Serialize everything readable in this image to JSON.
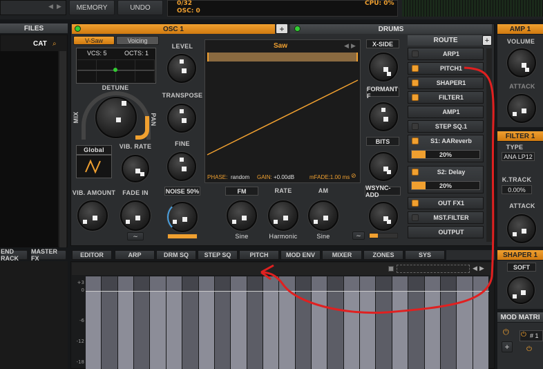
{
  "top": {
    "memory": "MEMORY",
    "undo": "UNDO",
    "voices": "0/32",
    "osc": "OSC: 0",
    "cpu": "CPU: 0%"
  },
  "files": {
    "title": "FILES",
    "cat": "CAT"
  },
  "osc": {
    "title": "OSC 1",
    "add": "+",
    "drums": "DRUMS",
    "vsaw_tab": "V-Saw",
    "voicing_tab": "Voicing",
    "vcs": "VCS: 5",
    "octs": "OCTS: 1",
    "detune": "DETUNE",
    "mix": "MIX",
    "pan": "PAN",
    "global": "Global",
    "vib_rate": "VIB. RATE",
    "vib_amount": "VIB. AMOUNT",
    "fade_in": "FADE IN",
    "level": "LEVEL",
    "transpose": "TRANSPOSE",
    "fine": "FINE",
    "noise": "NOISE 50%",
    "wave_name": "Saw",
    "phase_label": "PHASE:",
    "phase_val": "random",
    "gain_label": "GAIN:",
    "gain_val": "+0.00dB",
    "mfade": "mFADE:1.00 ms",
    "xside": "X-SIDE",
    "formant": "FORMANT F",
    "bits": "BITS",
    "wsync": "WSYNC-ADD",
    "fm": "FM",
    "rate": "RATE",
    "am": "AM",
    "fm_wave": "Sine",
    "rate_mode": "Harmonic",
    "am_wave": "Sine"
  },
  "route": {
    "title": "ROUTE",
    "add": "+",
    "items": [
      "ARP1",
      "PITCH1",
      "SHAPER1",
      "FILTER1",
      "AMP1",
      "STEP SQ.1",
      "S1: AAReverb",
      "S2: Delay",
      "OUT FX1",
      "MST.FILTER",
      "OUTPUT"
    ],
    "s1_pct": "20%",
    "s2_pct": "20%",
    "states": [
      false,
      true,
      true,
      true,
      null,
      false,
      true,
      true,
      true,
      false,
      null
    ]
  },
  "amp": {
    "title": "AMP 1",
    "volume": "VOLUME",
    "attack": "ATTACK"
  },
  "filter": {
    "title": "FILTER 1",
    "type": "TYPE",
    "type_val": "ANA LP12",
    "ktrack": "K.TRACK",
    "ktrack_val": "0.00%",
    "attack": "ATTACK"
  },
  "shaper": {
    "title": "SHAPER 1",
    "soft": "SOFT"
  },
  "modmatrix": {
    "title": "MOD MATRI",
    "row": "# 1"
  },
  "left": {
    "send_rack": "END RACK",
    "master_fx": "MASTER FX"
  },
  "tabs": [
    "EDITOR",
    "ARP",
    "DRM SQ",
    "STEP SQ",
    "PITCH",
    "MOD ENV",
    "MIXER",
    "ZONES",
    "SYS"
  ],
  "editor": {
    "y_labels": [
      "+3",
      "0",
      "-6",
      "-12",
      "-18"
    ]
  },
  "colors": {
    "accent": "#f0a030",
    "annotation": "#e02020"
  }
}
